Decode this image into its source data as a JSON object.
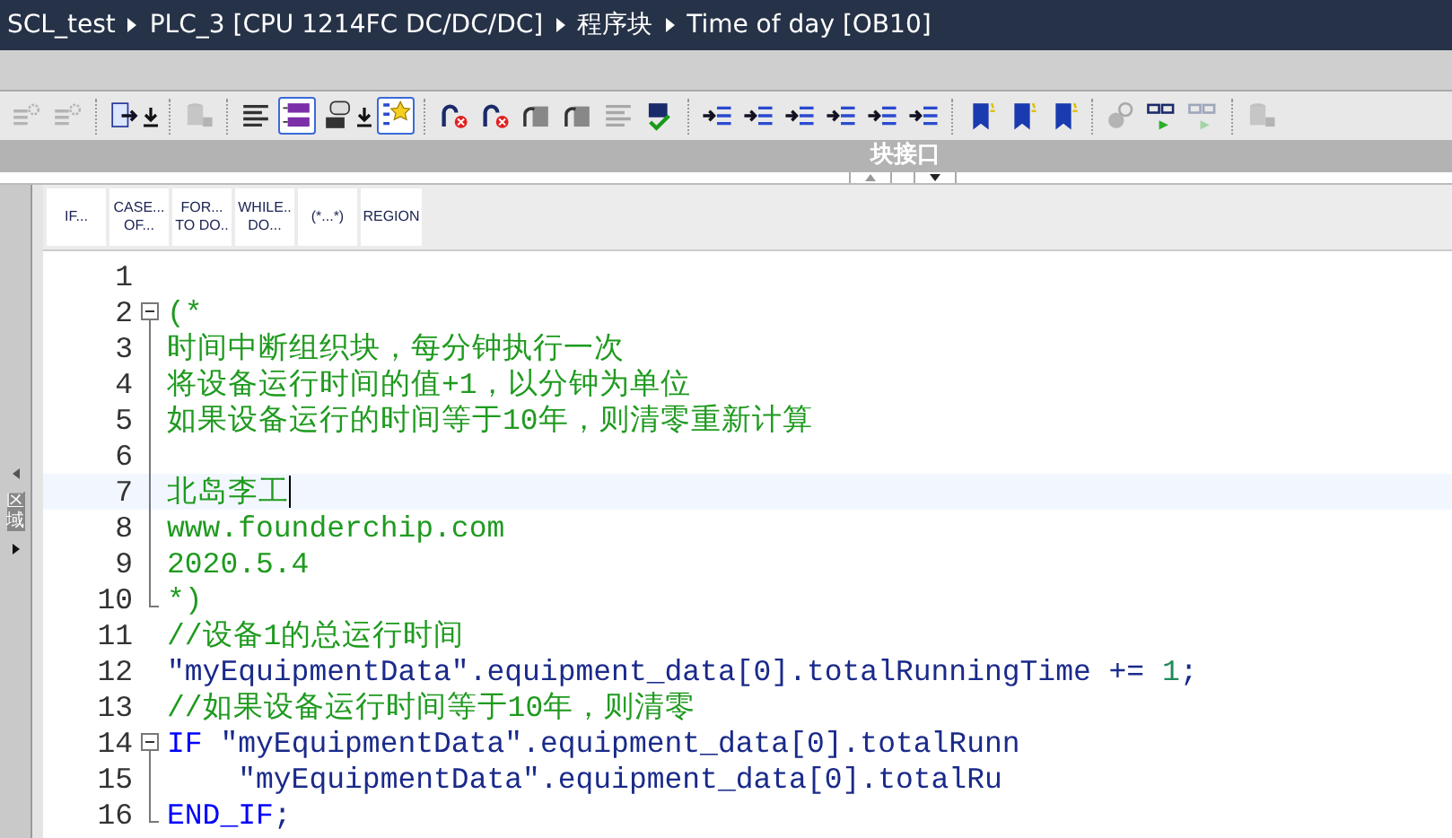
{
  "breadcrumb": [
    "SCL_test",
    "PLC_3 [CPU 1214FC DC/DC/DC]",
    "程序块",
    "Time of day [OB10]"
  ],
  "toolbar": {
    "groups": [
      [
        {
          "kind": "gear-lines",
          "disabled": true,
          "selected": false
        },
        {
          "kind": "gear-lines",
          "disabled": true,
          "selected": false
        }
      ],
      [
        {
          "kind": "doc-arrow",
          "disabled": false,
          "selected": false,
          "dropdown": true
        }
      ],
      [
        {
          "kind": "cylinder",
          "disabled": true,
          "selected": false
        }
      ],
      [
        {
          "kind": "lines",
          "disabled": false,
          "selected": false
        },
        {
          "kind": "tags",
          "disabled": false,
          "selected": true
        },
        {
          "kind": "comment",
          "disabled": false,
          "selected": false,
          "dropdown": true
        },
        {
          "kind": "star-list",
          "disabled": false,
          "selected": true
        }
      ],
      [
        {
          "kind": "arrow-cross",
          "disabled": false,
          "selected": false
        },
        {
          "kind": "arrow-cross",
          "disabled": false,
          "selected": false
        },
        {
          "kind": "arrow-doc",
          "disabled": false,
          "selected": false
        },
        {
          "kind": "arrow-doc",
          "disabled": false,
          "selected": false
        },
        {
          "kind": "lines",
          "disabled": true,
          "selected": false
        },
        {
          "kind": "check",
          "disabled": false,
          "selected": false
        }
      ],
      [
        {
          "kind": "indent",
          "disabled": false,
          "selected": false
        },
        {
          "kind": "indent",
          "disabled": false,
          "selected": false
        },
        {
          "kind": "indent",
          "disabled": false,
          "selected": false
        },
        {
          "kind": "indent",
          "disabled": false,
          "selected": false
        },
        {
          "kind": "indent",
          "disabled": false,
          "selected": false
        },
        {
          "kind": "indent",
          "disabled": false,
          "selected": false
        }
      ],
      [
        {
          "kind": "bookmark",
          "disabled": false,
          "selected": false
        },
        {
          "kind": "bookmark",
          "disabled": false,
          "selected": false
        },
        {
          "kind": "bookmark",
          "disabled": false,
          "selected": false
        }
      ],
      [
        {
          "kind": "magnifier",
          "disabled": true,
          "selected": false
        },
        {
          "kind": "glasses",
          "disabled": false,
          "selected": false
        },
        {
          "kind": "glasses",
          "disabled": true,
          "selected": false
        }
      ],
      [
        {
          "kind": "cylinder",
          "disabled": true,
          "selected": false
        }
      ]
    ]
  },
  "interface_bar": {
    "label": "块接口"
  },
  "side_panel": {
    "label": "区域"
  },
  "instructions": [
    {
      "label": "IF..."
    },
    {
      "label": "CASE...\nOF..."
    },
    {
      "label": "FOR...\nTO DO.."
    },
    {
      "label": "WHILE..\nDO..."
    },
    {
      "label": "(*...*)"
    },
    {
      "label": "REGION"
    }
  ],
  "lines": [
    {
      "number": "1",
      "kind": "plain",
      "current": false
    },
    {
      "number": "2",
      "kind": "fold-start",
      "current": false,
      "segments": [
        {
          "kind": "comment",
          "text": "(*"
        }
      ]
    },
    {
      "number": "3",
      "kind": "fold-body",
      "current": false,
      "segments": [
        {
          "kind": "comment",
          "text": "时间中断组织块，每分钟执行一次"
        }
      ]
    },
    {
      "number": "4",
      "kind": "fold-body",
      "current": false,
      "segments": [
        {
          "kind": "comment",
          "text": "将设备运行时间的值+1，以分钟为单位"
        }
      ]
    },
    {
      "number": "5",
      "kind": "fold-body",
      "current": false,
      "segments": [
        {
          "kind": "comment",
          "text": "如果设备运行的时间等于10年，则清零重新计算"
        }
      ]
    },
    {
      "number": "6",
      "kind": "fold-body",
      "current": false
    },
    {
      "number": "7",
      "kind": "fold-body",
      "current": true,
      "segments": [
        {
          "kind": "comment",
          "text": "北岛李工"
        }
      ]
    },
    {
      "number": "8",
      "kind": "fold-body",
      "current": false,
      "segments": [
        {
          "kind": "comment",
          "text": "www.founderchip.com"
        }
      ]
    },
    {
      "number": "9",
      "kind": "fold-body",
      "current": false,
      "segments": [
        {
          "kind": "comment",
          "text": "2020.5.4"
        }
      ]
    },
    {
      "number": "10",
      "kind": "fold-end",
      "current": false,
      "segments": [
        {
          "kind": "comment",
          "text": "*)"
        }
      ]
    },
    {
      "number": "11",
      "kind": "plain",
      "current": false,
      "segments": [
        {
          "kind": "comment",
          "text": "//设备1的总运行时间"
        }
      ]
    },
    {
      "number": "12",
      "kind": "plain",
      "current": false,
      "segments": [
        {
          "kind": "code",
          "text": "\"myEquipmentData\".equipment_data[0].totalRunningTime += "
        },
        {
          "kind": "number",
          "text": "1"
        },
        {
          "kind": "code",
          "text": ";"
        }
      ]
    },
    {
      "number": "13",
      "kind": "plain",
      "current": false,
      "segments": [
        {
          "kind": "comment",
          "text": "//如果设备运行时间等于10年，则清零"
        }
      ]
    },
    {
      "number": "14",
      "kind": "fold-start",
      "current": false,
      "segments": [
        {
          "kind": "keyword",
          "text": "IF"
        },
        {
          "kind": "code",
          "text": " \"myEquipmentData\".equipment_data[0].totalRunn"
        }
      ]
    },
    {
      "number": "15",
      "kind": "fold-body",
      "current": false,
      "segments": [
        {
          "kind": "code",
          "text": "    \"myEquipmentData\".equipment_data[0].totalRu"
        }
      ]
    },
    {
      "number": "16",
      "kind": "fold-end",
      "current": false,
      "segments": [
        {
          "kind": "keyword",
          "text": "END_IF"
        },
        {
          "kind": "code",
          "text": ";"
        }
      ]
    }
  ]
}
